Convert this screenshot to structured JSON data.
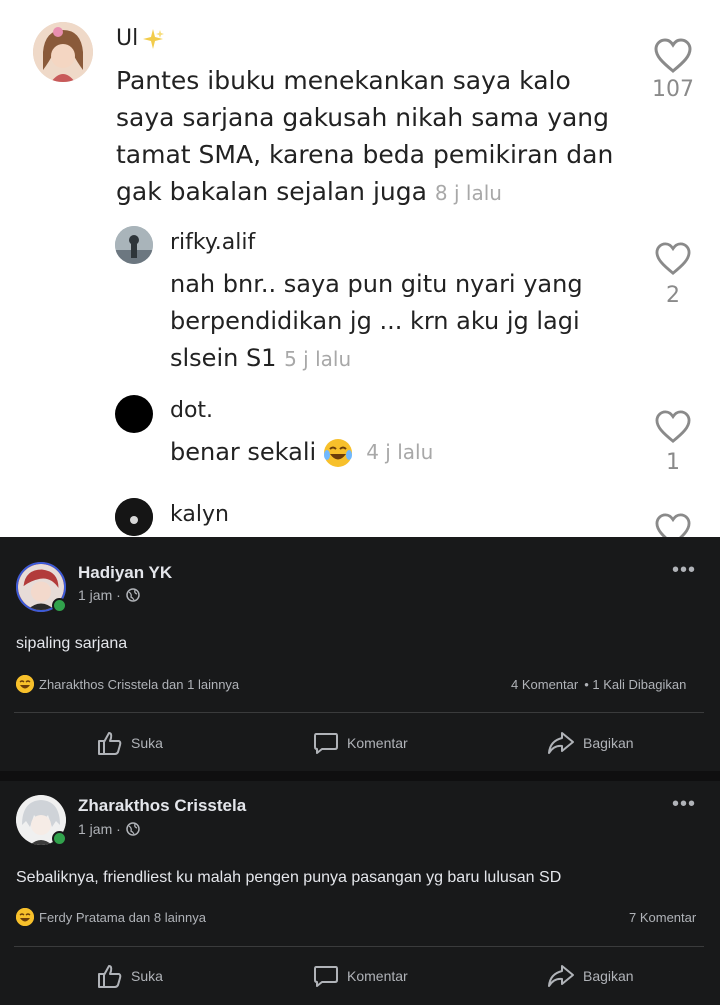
{
  "thread": {
    "main": {
      "user": "Ul",
      "text": "Pantes ibuku menekankan saya kalo saya sarjana gakusah nikah sama yang tamat SMA, karena beda pemikiran dan gak bakalan sejalan juga",
      "time": "8 j lalu",
      "likes": "107"
    },
    "replies": [
      {
        "user": "rifky.alif",
        "text": "nah bnr.. saya pun gitu nyari yang berpendidikan jg ... krn aku jg lagi slsein S1",
        "time": "5 j lalu",
        "likes": "2"
      },
      {
        "user": "dot.",
        "text": "benar sekali",
        "time": "4 j lalu",
        "likes": "1"
      },
      {
        "user": "kalyn"
      }
    ]
  },
  "posts": [
    {
      "author": "Hadiyan YK",
      "time": "1 jam ·",
      "text": "sipaling sarjana",
      "reactions": "Zharakthos Crisstela dan 1 lainnya",
      "comments": "4 Komentar",
      "shares": "• 1 Kali Dibagikan",
      "actions": {
        "like": "Suka",
        "comment": "Komentar",
        "share": "Bagikan"
      }
    },
    {
      "author": "Zharakthos Crisstela",
      "time": "1 jam ·",
      "text": "Sebaliknya, friendliest ku malah pengen punya pasangan yg baru lulusan SD",
      "reactions": "Ferdy Pratama dan 8 lainnya",
      "comments": "7 Komentar",
      "actions": {
        "like": "Suka",
        "comment": "Komentar",
        "share": "Bagikan"
      }
    }
  ],
  "colors": {
    "online": "#31a24c",
    "dark_bg": "#18191a",
    "emoji": "#f7c02b"
  }
}
